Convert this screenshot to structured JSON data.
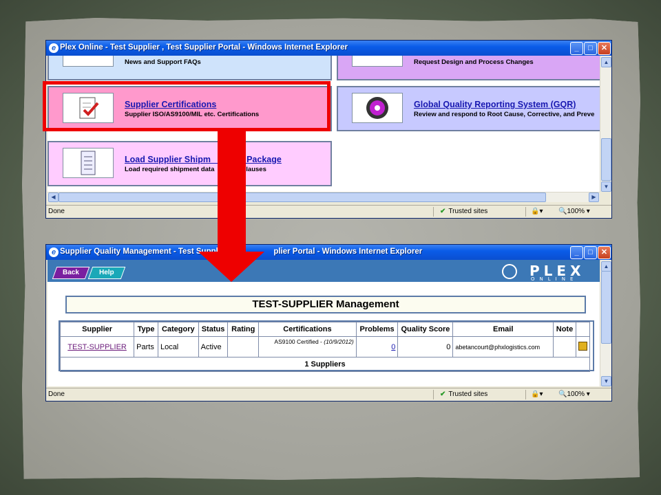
{
  "window1": {
    "title": "Plex Online - Test Supplier , Test Supplier Portal - Windows Internet Explorer",
    "tiles": [
      {
        "desc": "News and Support FAQs"
      },
      {
        "desc": "Request Design and Process Changes"
      },
      {
        "link": "Supplier Certifications",
        "desc": "Supplier ISO/AS9100/MIL etc. Certifications"
      },
      {
        "link": "Global Quality Reporting System (GQR)",
        "desc": "Review and respond to Root Cause, Corrective, and Preve"
      },
      {
        "link": "Load Supplier Shipm   ta Package",
        "desc": "Load required shipment data   Q-Clauses"
      }
    ],
    "status": {
      "left": "Done",
      "zone": "Trusted sites",
      "zoom": "100%"
    }
  },
  "window2": {
    "title": "Supplier Quality Management - Test Suppl       plier Portal - Windows Internet Explorer",
    "toolbar": {
      "back": "Back",
      "help": "Help"
    },
    "logo": {
      "word": "PLEX",
      "sub": "ONLINE"
    },
    "heading": "TEST-SUPPLIER Management",
    "table": {
      "headers": [
        "Supplier",
        "Type",
        "Category",
        "Status",
        "Rating",
        "Certifications",
        "Problems",
        "Quality Score",
        "Email",
        "Note"
      ],
      "row": {
        "supplier": "TEST-SUPPLIER",
        "type": "Parts",
        "category": "Local",
        "status": "Active",
        "rating": "",
        "cert_name": "AS9100 Certified - ",
        "cert_date": "(10/9/2012)",
        "problems": "0",
        "quality_score": "0",
        "email": "abetancourt@phxlogistics.com",
        "note": ""
      },
      "footer": "1 Suppliers"
    },
    "status": {
      "left": "Done",
      "zone": "Trusted sites",
      "zoom": "100%"
    }
  },
  "colors": {
    "highlight": "#ee0000",
    "tile_blue": "#cfe3fb",
    "tile_lavender": "#d9a6f5",
    "tile_pink": "#ff99cc",
    "tile_light_pink": "#ffccff",
    "tile_periwinkle": "#c7c9ff",
    "toolbar": "#3c78b6"
  }
}
